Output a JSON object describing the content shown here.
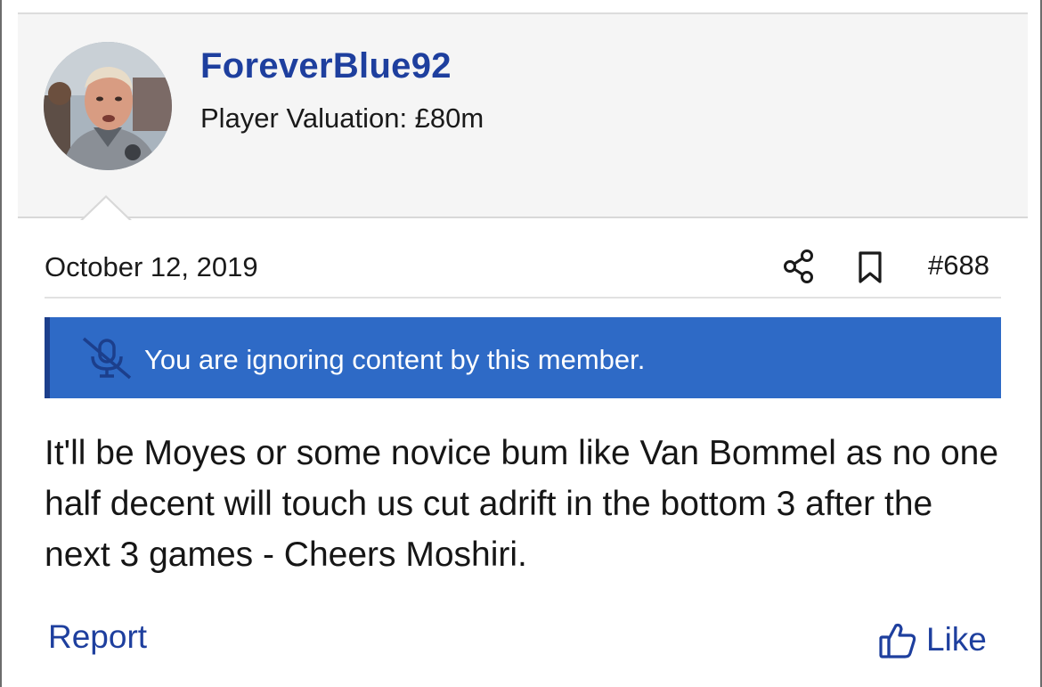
{
  "post": {
    "author": {
      "username": "ForeverBlue92",
      "valuation": "Player Valuation: £80m",
      "avatar": "user-photo"
    },
    "date": "October 12, 2019",
    "post_number": "#688",
    "notice": {
      "text": "You are ignoring content by this member.",
      "icon": "muted-microphone-icon"
    },
    "message": "It'll be Moyes or some novice bum like Van Bommel as no one half decent will touch us cut adrift in the bottom 3 after the next 3 games - Cheers Moshiri.",
    "actions": {
      "report_label": "Report",
      "like_label": "Like"
    },
    "icons": {
      "share": "share-icon",
      "bookmark": "bookmark-icon",
      "like": "thumbs-up-icon"
    }
  },
  "colors": {
    "accent": "#1e3f9e",
    "notice_bg": "#2e6ac6",
    "notice_border": "#1c3f8c",
    "header_bg": "#f5f5f5"
  }
}
